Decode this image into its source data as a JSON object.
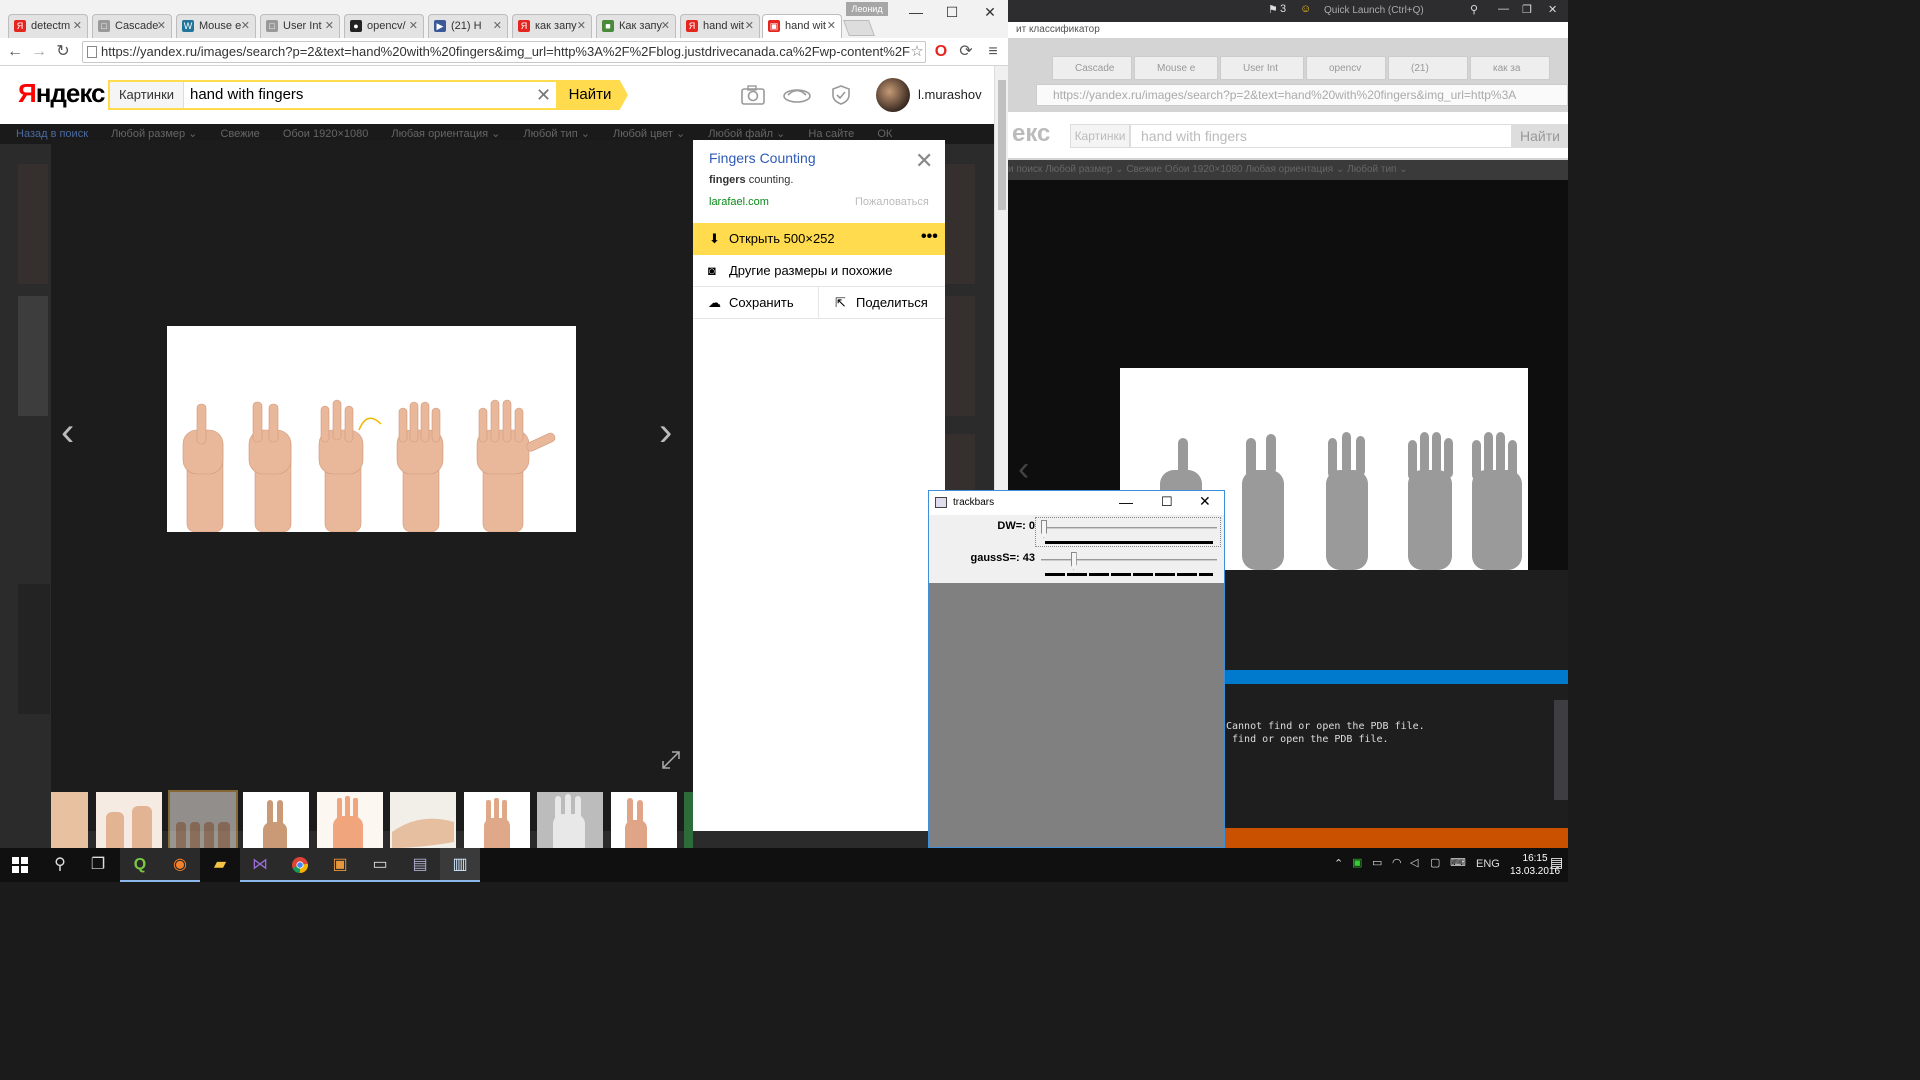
{
  "background_app": {
    "window_title": "ит классификатор",
    "quick_launch": "Quick Launch (Ctrl+Q)",
    "notification_count": "3",
    "tabs": [
      "Cascade",
      "Mouse e",
      "User Int",
      "opencv",
      "(21)",
      "как за"
    ],
    "address": "https://yandex.ru/images/search?p=2&text=hand%20with%20fingers&img_url=http%3A",
    "search_label": "Картинки",
    "search_query": "hand with fingers",
    "search_button": "Найти",
    "filters": "и поиск   Любой размер ⌄   Свежие   Обои 1920×1080   Любая ориентация ⌄   Любой тип ⌄",
    "output_lines": "Cannot find or open the PDB file.\n find or open the PDB file."
  },
  "browser": {
    "user_badge": "Леонид",
    "tabs": [
      {
        "label": "detectm",
        "fav": "Я",
        "color": "#e52620"
      },
      {
        "label": "Cascade",
        "fav": "□",
        "color": "#999999"
      },
      {
        "label": "Mouse e",
        "fav": "W",
        "color": "#21759b"
      },
      {
        "label": "User Int",
        "fav": "□",
        "color": "#999999"
      },
      {
        "label": "opencv/",
        "fav": "●",
        "color": "#222222"
      },
      {
        "label": "(21) H",
        "fav": "▶",
        "color": "#3b5998"
      },
      {
        "label": "как запу",
        "fav": "Я",
        "color": "#e52620"
      },
      {
        "label": "Как запу",
        "fav": "■",
        "color": "#4a8a3a"
      },
      {
        "label": "hand wit",
        "fav": "Я",
        "color": "#e52620"
      },
      {
        "label": "hand wit",
        "fav": "▣",
        "color": "#e52620"
      }
    ],
    "address": "https://yandex.ru/images/search?p=2&text=hand%20with%20fingers&img_url=http%3A%2F%2Fblog.justdrivecanada.ca%2Fwp-content%2F"
  },
  "yandex": {
    "logo": "Яндекс",
    "search_label": "Картинки",
    "search_value": "hand with fingers",
    "search_button": "Найти",
    "username": "l.murashov",
    "filters": {
      "back": "Назад в поиск",
      "items": [
        "Любой размер ⌄",
        "Свежие",
        "Обои 1920×1080",
        "Любая ориентация ⌄",
        "Любой тип ⌄",
        "Любой цвет ⌄",
        "Любой файл ⌄",
        "На сайте",
        "ОК"
      ]
    }
  },
  "panel": {
    "title": "Fingers Counting",
    "desc_bold": "fingers",
    "desc_rest": " counting.",
    "domain": "larafael.com",
    "report": "Пожаловаться",
    "open": "Открыть 500×252",
    "similar": "Другие размеры и похожие",
    "save": "Сохранить",
    "share": "Поделиться"
  },
  "trackbars": {
    "title": "trackbars",
    "dw_label": "DW=: 0",
    "dw_value": 0,
    "gauss_label": "gaussS=: 43",
    "gauss_value": 43
  },
  "taskbar": {
    "lang": "ENG",
    "time": "16:15",
    "date": "13.03.2016"
  },
  "icons": {
    "start": "windows-start-icon",
    "search": "search-icon",
    "taskview": "task-view-icon"
  }
}
